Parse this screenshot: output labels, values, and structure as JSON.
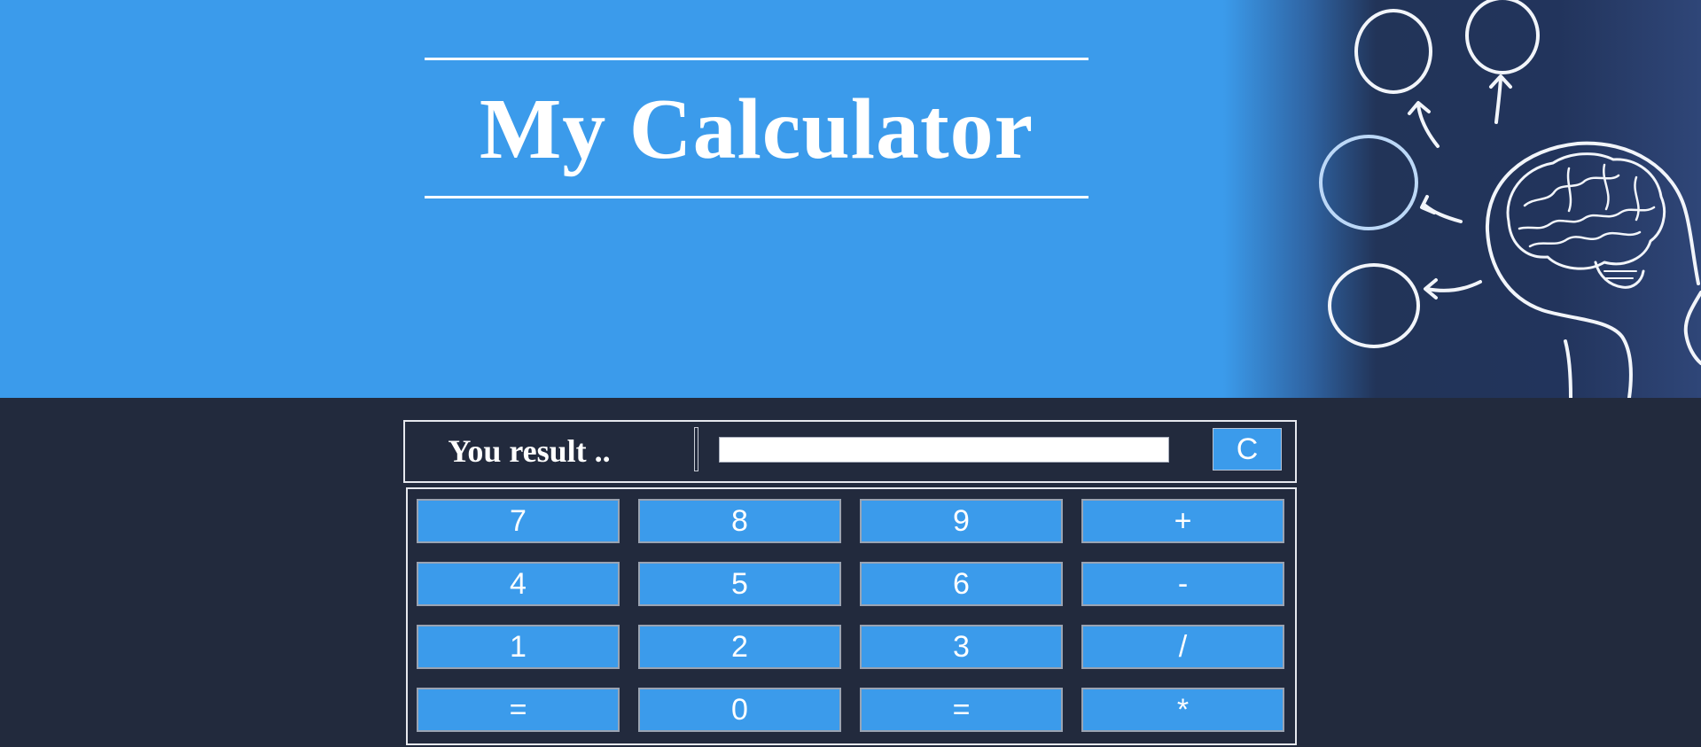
{
  "header": {
    "title": "My Calculator",
    "background_color": "#3b9beb",
    "art_icon": "brain-head-icon"
  },
  "result": {
    "label": "You result ..",
    "value": "",
    "clear_label": "C"
  },
  "keypad": {
    "rows": [
      [
        "7",
        "8",
        "9",
        "+"
      ],
      [
        "4",
        "5",
        "6",
        "-"
      ],
      [
        "1",
        "2",
        "3",
        "/"
      ],
      [
        "=",
        "0",
        "=",
        "*"
      ]
    ],
    "key_color": "#3b9beb"
  },
  "theme": {
    "page_background": "#222a3d",
    "accent": "#3b9beb"
  }
}
